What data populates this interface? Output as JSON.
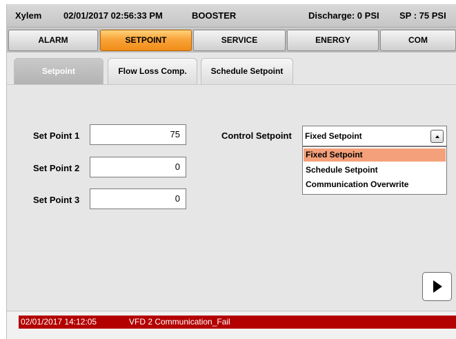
{
  "header": {
    "brand": "Xylem",
    "datetime": "02/01/2017 02:56:33 PM",
    "mode": "BOOSTER",
    "discharge": "Discharge: 0 PSI",
    "setpoint": "SP : 75 PSI"
  },
  "nav": {
    "tabs": [
      {
        "label": "ALARM",
        "active": false
      },
      {
        "label": "SETPOINT",
        "active": true
      },
      {
        "label": "SERVICE",
        "active": false
      },
      {
        "label": "ENERGY",
        "active": false
      },
      {
        "label": "COM",
        "active": false
      }
    ]
  },
  "subtabs": [
    {
      "label": "Setpoint",
      "active": true
    },
    {
      "label": "Flow Loss Comp.",
      "active": false
    },
    {
      "label": "Schedule Setpoint",
      "active": false
    }
  ],
  "setpoints": [
    {
      "label": "Set Point 1",
      "value": "75"
    },
    {
      "label": "Set Point 2",
      "value": "0"
    },
    {
      "label": "Set Point 3",
      "value": "0"
    }
  ],
  "control_setpoint": {
    "label": "Control Setpoint",
    "selected": "Fixed Setpoint",
    "options": [
      "Fixed Setpoint",
      "Schedule Setpoint",
      "Communication Overwrite"
    ]
  },
  "alarm": {
    "timestamp": "02/01/2017 14:12:05",
    "message": "VFD 2 Communication_Fail"
  },
  "icons": {
    "next": "play-right-icon",
    "dropdown": "chevron-up-icon"
  },
  "colors": {
    "active_tab": "#f9a43a",
    "selected_option": "#f4a07a",
    "alarm_background": "#b30000"
  }
}
